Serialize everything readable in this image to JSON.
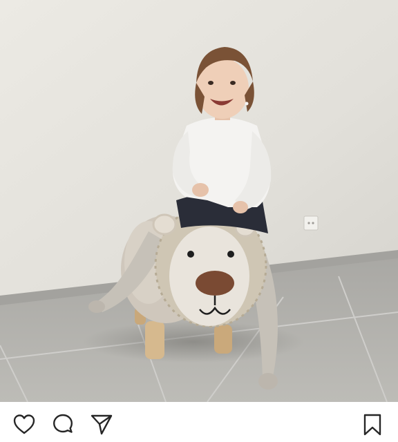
{
  "post": {
    "photo": {
      "alt_subject": "child-on-lion-stool"
    },
    "actions": {
      "like": {
        "icon": "heart-icon"
      },
      "comment": {
        "icon": "comment-bubble-icon"
      },
      "share": {
        "icon": "paper-plane-icon"
      },
      "save": {
        "icon": "bookmark-icon"
      }
    },
    "colors": {
      "wall": "#e6e4de",
      "floor": "#b4b3af",
      "icon_stroke": "#262626"
    }
  }
}
